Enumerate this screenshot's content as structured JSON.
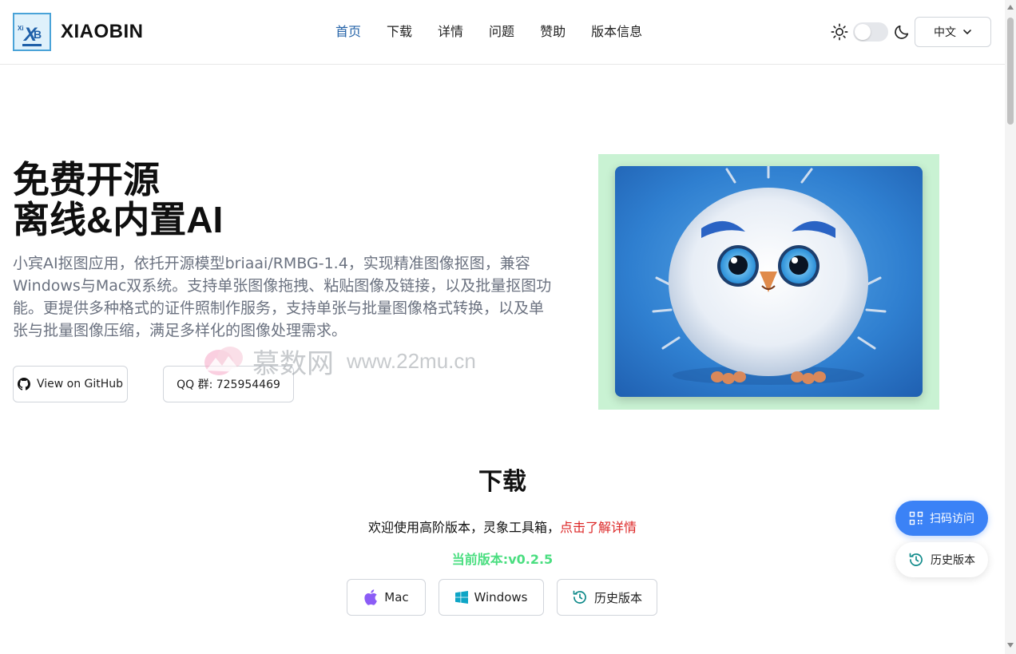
{
  "header": {
    "brand": "XIAOBIN",
    "nav": [
      {
        "label": "首页",
        "active": true
      },
      {
        "label": "下载",
        "active": false
      },
      {
        "label": "详情",
        "active": false
      },
      {
        "label": "问题",
        "active": false
      },
      {
        "label": "赞助",
        "active": false
      },
      {
        "label": "版本信息",
        "active": false
      }
    ],
    "language": "中文",
    "theme_icons": [
      "sun-icon",
      "moon-icon"
    ]
  },
  "hero": {
    "title_line1": "免费开源",
    "title_line2": "离线&内置AI",
    "description": "小宾AI抠图应用，依托开源模型briaai/RMBG-1.4，实现精准图像抠图，兼容Windows与Mac双系统。支持单张图像拖拽、粘贴图像及链接，以及批量抠图功能。更提供多种格式的证件照制作服务，支持单张与批量图像格式转换，以及单张与批量图像压缩，满足多样化的图像处理需求。",
    "github_label": "View on GitHub",
    "qq_label": "QQ 群: 725954469"
  },
  "watermark": {
    "cn": "慕数网",
    "url": "www.22mu.cn"
  },
  "download": {
    "title": "下载",
    "welcome": "欢迎使用高阶版本，灵象工具箱，",
    "welcome_link": "点击了解详情",
    "version": "当前版本:v0.2.5",
    "mac_label": "Mac",
    "windows_label": "Windows",
    "history_label": "历史版本"
  },
  "floating": {
    "scan_label": "扫码访问",
    "history_label": "历史版本"
  },
  "colors": {
    "accent": "#3b82f6",
    "nav_active": "#2563a8",
    "link_red": "#dc2626",
    "version_green": "#4ade80",
    "image_bg": "#c9f2d3"
  }
}
